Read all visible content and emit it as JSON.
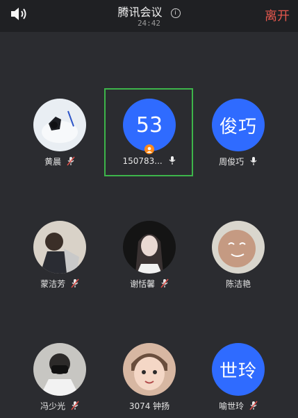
{
  "header": {
    "title": "腾讯会议",
    "timer": "24:42",
    "leave_label": "离开",
    "speaker_icon": "speaker-icon",
    "info_icon": "info-icon"
  },
  "participants": [
    {
      "name": "黄晨",
      "avatar_type": "photo",
      "mic": "muted"
    },
    {
      "name": "150783...",
      "avatar_text": "53",
      "avatar_type": "text",
      "mic": "on",
      "host": true,
      "selected": true
    },
    {
      "name": "周俊巧",
      "avatar_text": "俊巧",
      "avatar_type": "text",
      "mic": "on"
    },
    {
      "name": "蒙洁芳",
      "avatar_type": "photo",
      "mic": "muted"
    },
    {
      "name": "谢恬馨",
      "avatar_type": "photo",
      "mic": "muted"
    },
    {
      "name": "陈洁艳",
      "avatar_type": "photo",
      "mic": "none"
    },
    {
      "name": "冯少光",
      "avatar_type": "photo",
      "mic": "muted"
    },
    {
      "name": "3074 钟扬",
      "avatar_type": "photo",
      "mic": "none"
    },
    {
      "name": "喻世玲",
      "avatar_text": "世玲",
      "avatar_type": "text",
      "mic": "muted"
    }
  ],
  "colors": {
    "accent": "#2f6bff",
    "leave": "#e5574d",
    "selected_border": "#3db54a",
    "muted_icon": "#e0504a",
    "host_badge": "#ff8a1a"
  }
}
